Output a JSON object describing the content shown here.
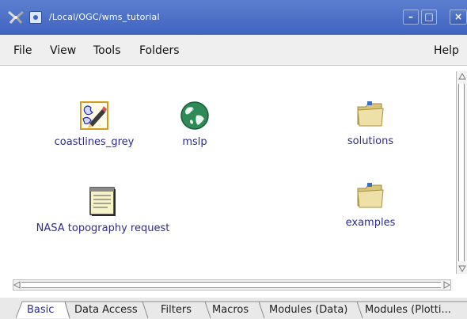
{
  "window": {
    "title": "/Local/OGC/wms_tutorial",
    "minimize_glyph": "–",
    "maximize_glyph": "□",
    "close_glyph": "×"
  },
  "menubar": {
    "items": [
      {
        "label": "File"
      },
      {
        "label": "View"
      },
      {
        "label": "Tools"
      },
      {
        "label": "Folders"
      },
      {
        "label": "Help"
      }
    ]
  },
  "icons": [
    {
      "label": "coastlines_grey",
      "icon": "coastline-map-icon"
    },
    {
      "label": "mslp",
      "icon": "globe-icon"
    },
    {
      "label": "solutions",
      "icon": "folder-icon"
    },
    {
      "label": "NASA topography request",
      "icon": "notepad-icon"
    },
    {
      "label": "examples",
      "icon": "folder-icon"
    }
  ],
  "tabs": [
    {
      "label": "Basic",
      "active": true
    },
    {
      "label": "Data Access"
    },
    {
      "label": "Filters"
    },
    {
      "label": "Macros"
    },
    {
      "label": "Modules (Data)"
    },
    {
      "label": "Modules (Plotti..."
    }
  ],
  "colors": {
    "titlebar": "#4a6fc7",
    "label_text": "#2c2c8c",
    "folder": "#e8d597"
  }
}
